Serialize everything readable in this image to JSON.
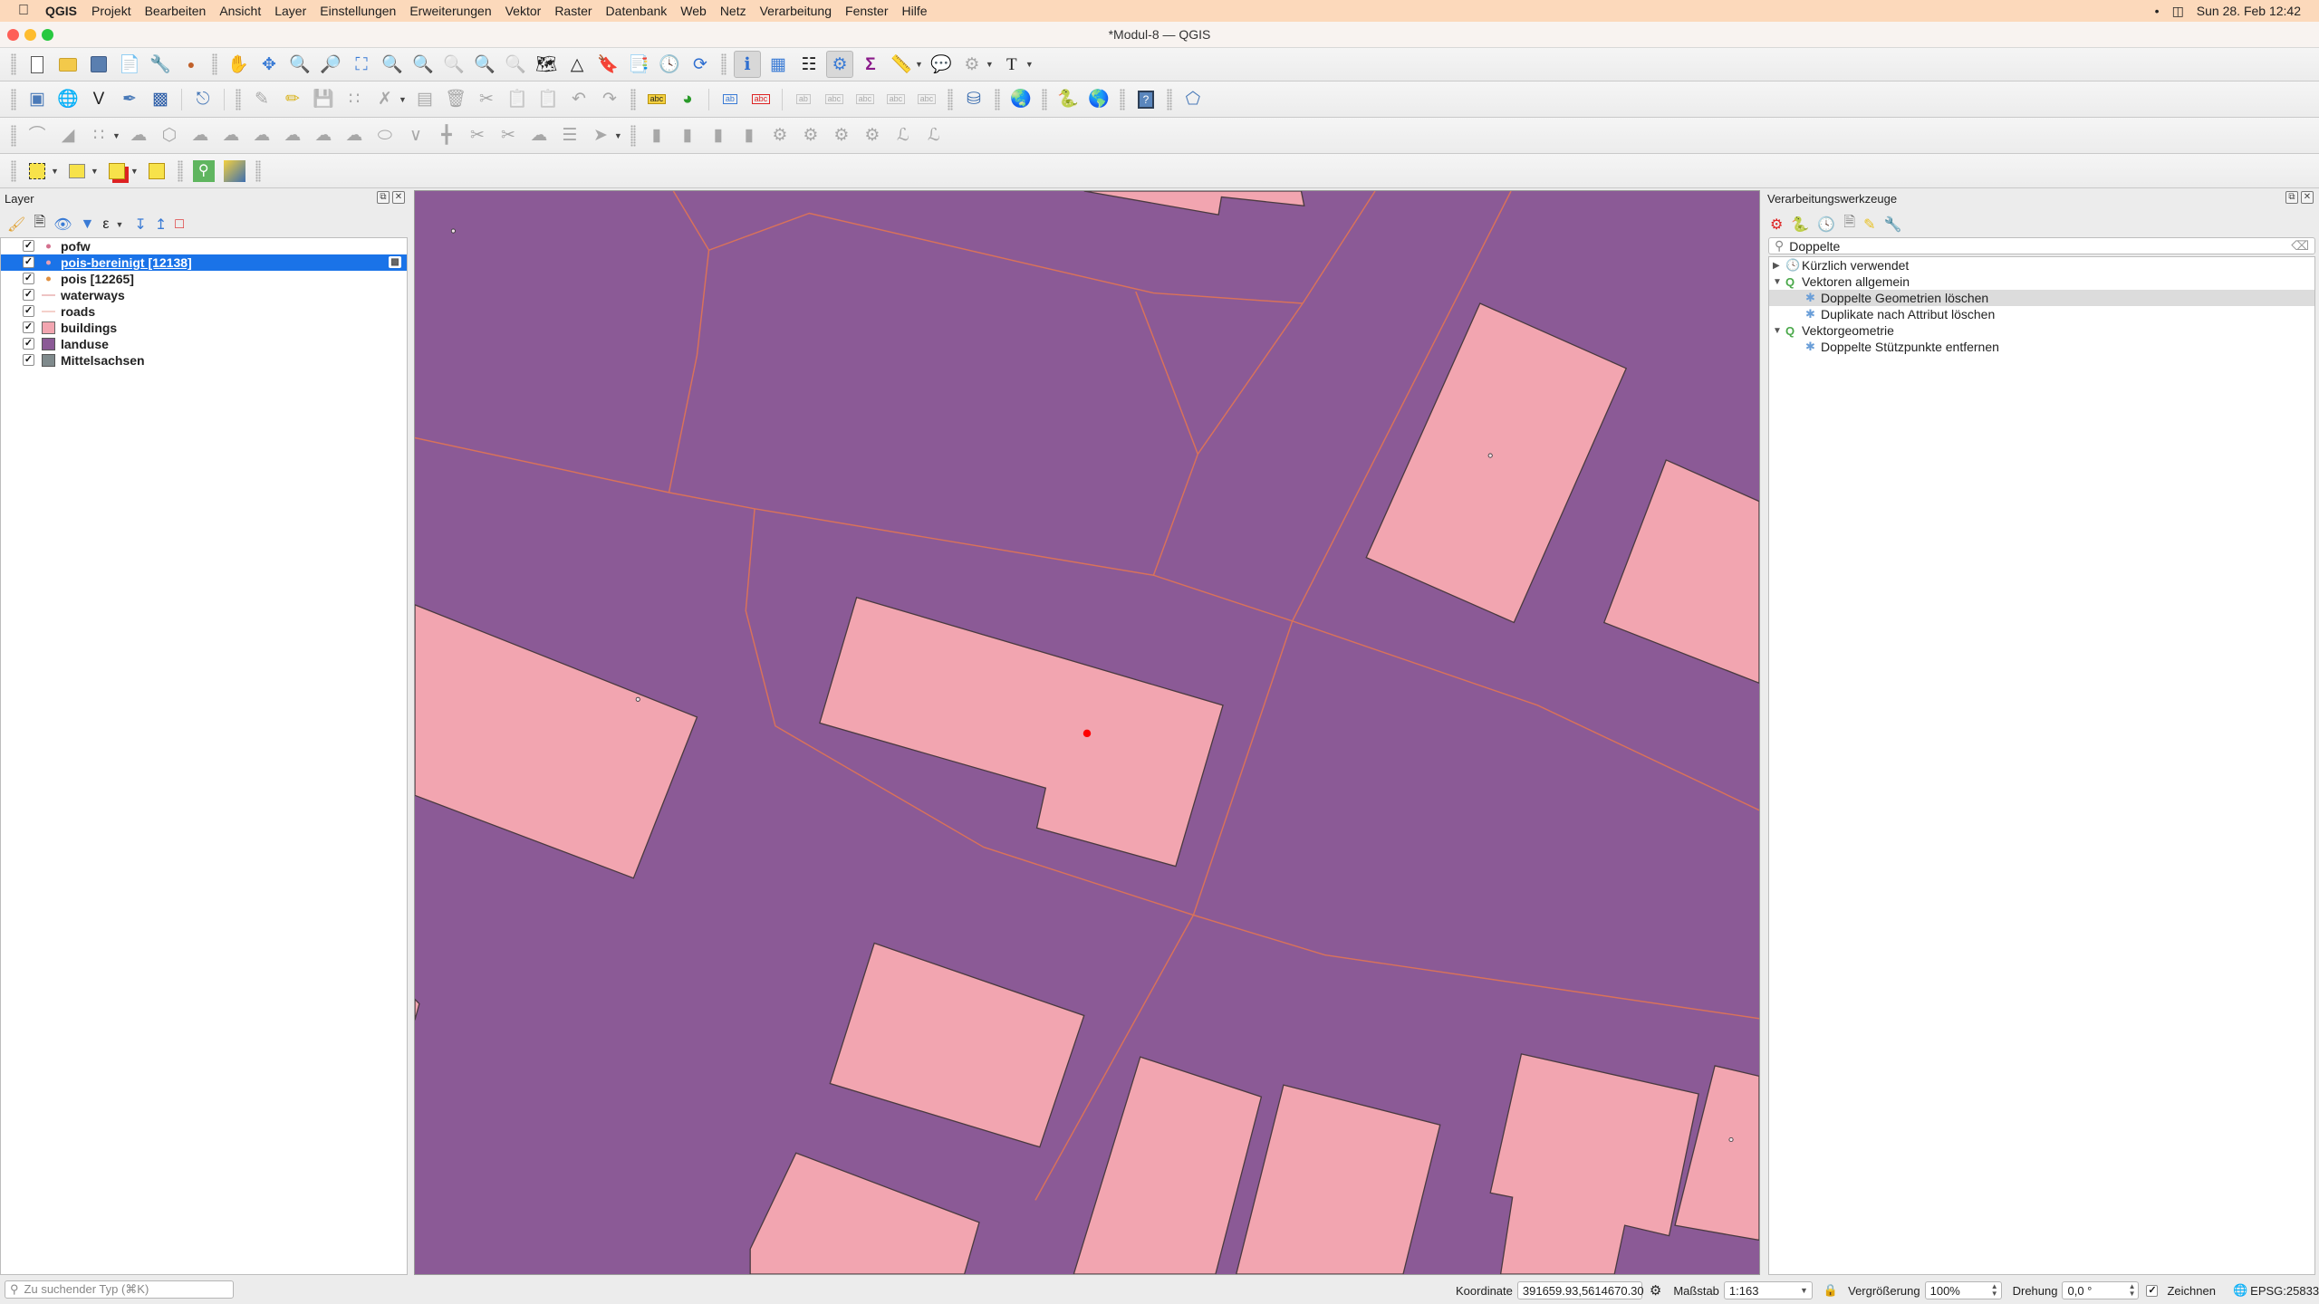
{
  "menubar": {
    "app": "QGIS",
    "items": [
      "Projekt",
      "Bearbeiten",
      "Ansicht",
      "Layer",
      "Einstellungen",
      "Erweiterungen",
      "Vektor",
      "Raster",
      "Datenbank",
      "Web",
      "Netz",
      "Verarbeitung",
      "Fenster",
      "Hilfe"
    ],
    "datetime": "Sun 28. Feb  12:42"
  },
  "window": {
    "title": "*Modul-8 — QGIS"
  },
  "toolbars": {
    "row1": [
      "new-project",
      "open-project",
      "save-project",
      "new-print-layout",
      "layout-manager",
      "style-manager",
      "pan-map",
      "pan-to-selection",
      "zoom-in",
      "zoom-out",
      "zoom-full",
      "zoom-to-selection",
      "zoom-to-layer",
      "zoom-native",
      "zoom-last",
      "zoom-next",
      "new-map-view",
      "new-3d-map-view",
      "new-bookmark",
      "show-bookmarks",
      "temporal-controller",
      "refresh",
      "identify-features",
      "open-attribute-table",
      "statistical-summary",
      "processing-toolbox",
      "field-calculator",
      "measure-line",
      "map-tips",
      "select-by-location",
      "text-annotation"
    ],
    "row2": [
      "data-source-manager",
      "new-geopackage-layer",
      "new-shapefile-layer",
      "new-spatialite-layer",
      "new-temporary-scratch-layer",
      "new-virtual-layer",
      "current-edits",
      "toggle-editing",
      "save-layer-edits",
      "digitize-point",
      "vertex-tool",
      "modify-attributes",
      "delete-selected",
      "cut-features",
      "copy-features",
      "paste-features",
      "undo",
      "redo",
      "label-tool",
      "diagram-options",
      "highlight-pinned-labels",
      "toggle-label-display",
      "pin-labels",
      "show-hide-labels",
      "move-label",
      "rotate-label",
      "change-label",
      "db-manager",
      "metasearch",
      "python-console",
      "osm-place-search",
      "help-contents",
      "topology-checker"
    ]
  },
  "layers_panel": {
    "title": "Layer",
    "layers": [
      {
        "name": "pofw",
        "checked": true,
        "symbol": "point",
        "color": "#d4708e",
        "selected": false
      },
      {
        "name": "pois-bereinigt [12138]",
        "checked": true,
        "symbol": "point",
        "color": "#e8a0b4",
        "selected": true
      },
      {
        "name": "pois [12265]",
        "checked": true,
        "symbol": "point",
        "color": "#e09040",
        "selected": false
      },
      {
        "name": "waterways",
        "checked": true,
        "symbol": "line",
        "color": "#e8b0b0",
        "selected": false
      },
      {
        "name": "roads",
        "checked": true,
        "symbol": "line",
        "color": "#f0c0b8",
        "selected": false
      },
      {
        "name": "buildings",
        "checked": true,
        "symbol": "fill",
        "color": "#f2a5b0",
        "selected": false
      },
      {
        "name": "landuse",
        "checked": true,
        "symbol": "fill",
        "color": "#8b5a96",
        "selected": false
      },
      {
        "name": "Mittelsachsen",
        "checked": true,
        "symbol": "fill",
        "color": "#7f8a8c",
        "selected": false
      }
    ]
  },
  "processing_panel": {
    "title": "Verarbeitungswerkzeuge",
    "search_value": "Doppelte",
    "tree": [
      {
        "label": "Kürzlich verwendet",
        "level": 0,
        "expanded": false,
        "icon": "clock-icon"
      },
      {
        "label": "Vektoren allgemein",
        "level": 0,
        "expanded": true,
        "icon": "qgis-icon"
      },
      {
        "label": "Doppelte Geometrien löschen",
        "level": 1,
        "icon": "algorithm-icon",
        "highlighted": true
      },
      {
        "label": "Duplikate nach Attribut löschen",
        "level": 1,
        "icon": "algorithm-icon"
      },
      {
        "label": "Vektorgeometrie",
        "level": 0,
        "expanded": true,
        "icon": "qgis-icon"
      },
      {
        "label": "Doppelte Stützpunkte entfernen",
        "level": 1,
        "icon": "algorithm-icon"
      }
    ]
  },
  "map": {
    "landuse_color": "#8b5a96",
    "building_color": "#f2a5b0",
    "road_color": "#d9725a",
    "highlight_point_color": "#ff0000"
  },
  "statusbar": {
    "locator_placeholder": "Zu suchender Typ (⌘K)",
    "coordinate_label": "Koordinate",
    "coordinate_value": "391659.93,5614670.30",
    "scale_label": "Maßstab",
    "scale_value": "1:163",
    "magnifier_label": "Vergrößerung",
    "magnifier_value": "100%",
    "rotation_label": "Drehung",
    "rotation_value": "0,0 °",
    "render_label": "Zeichnen",
    "render_checked": true,
    "crs": "EPSG:25833"
  }
}
